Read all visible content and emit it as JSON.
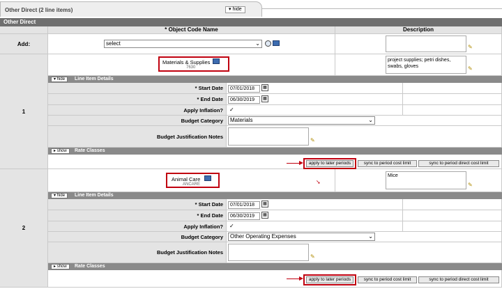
{
  "tab": {
    "title": "Other Direct (2 line items)",
    "hide_label": "hide"
  },
  "section": {
    "title": "Other Direct"
  },
  "table": {
    "col_object_code": "* Object Code Name",
    "col_description": "Description"
  },
  "add_row": {
    "label": "Add:",
    "select_value": "select"
  },
  "items": [
    {
      "number": "1",
      "object_name": "Materials & Supplies",
      "object_code": "7630",
      "description": "project supplies; petri dishes, swabs, gloves",
      "details_label": "Line Item Details",
      "hide_label": "hide",
      "start_date_label": "* Start Date",
      "start_date": "07/01/2018",
      "end_date_label": "* End Date",
      "end_date": "06/30/2019",
      "inflation_label": "Apply Inflation?",
      "inflation_checked": "✓",
      "category_label": "Budget Category",
      "category_value": "Materials",
      "justification_label": "Budget Justification Notes",
      "rate_classes_label": "Rate Classes",
      "show_label": "show",
      "apply_label": "apply to later periods",
      "sync_label": "sync to period cost limit",
      "sync_direct_label": "sync to period direct cost limit"
    },
    {
      "number": "2",
      "object_name": "Animal Care",
      "object_code": "ANCARE",
      "description": "Mice",
      "details_label": "Line Item Details",
      "hide_label": "hide",
      "start_date_label": "* Start Date",
      "start_date": "07/01/2018",
      "end_date_label": "* End Date",
      "end_date": "06/30/2019",
      "inflation_label": "Apply Inflation?",
      "inflation_checked": "✓",
      "category_label": "Budget Category",
      "category_value": "Other Operating Expenses",
      "justification_label": "Budget Justification Notes",
      "rate_classes_label": "Rate Classes",
      "show_label": "show",
      "apply_label": "apply to later periods",
      "sync_label": "sync to period cost limit",
      "sync_direct_label": "sync to period direct cost limit"
    }
  ],
  "colors": {
    "highlight": "#c0000f",
    "section_header": "#6f6f6f",
    "subbar": "#8a8a8a"
  }
}
